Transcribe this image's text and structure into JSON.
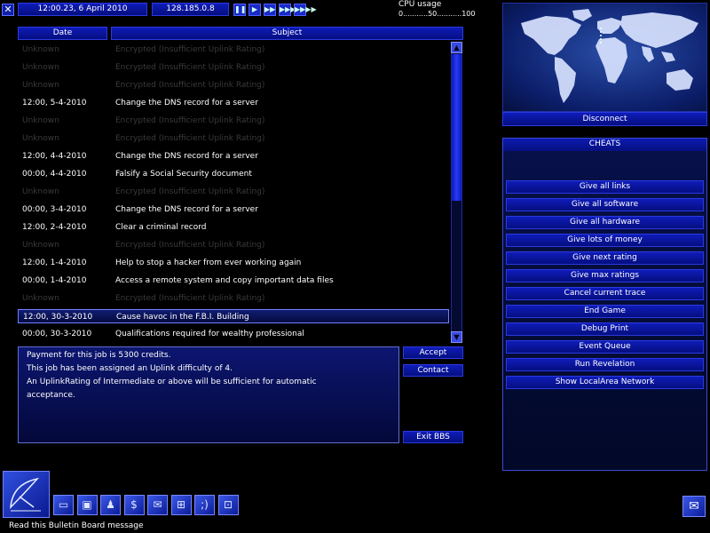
{
  "top_bar": {
    "close_glyph": "✕",
    "datetime": "12:00.23, 6 April 2010",
    "ip_address": "128.185.0.8",
    "speed_buttons": [
      "❚❚",
      "▶",
      "▶▶",
      "▶▶▶",
      "▶▶▶▶"
    ],
    "cpu_label": "CPU usage",
    "cpu_scale": "0...........50...........100"
  },
  "table": {
    "headers": {
      "date": "Date",
      "subject": "Subject"
    },
    "rows": [
      {
        "date": "Unknown",
        "subject": "Encrypted (Insufficient Uplink Rating)",
        "encrypted": true
      },
      {
        "date": "Unknown",
        "subject": "Encrypted (Insufficient Uplink Rating)",
        "encrypted": true
      },
      {
        "date": "Unknown",
        "subject": "Encrypted (Insufficient Uplink Rating)",
        "encrypted": true
      },
      {
        "date": "12:00, 5-4-2010",
        "subject": "Change the DNS record for a server",
        "encrypted": false
      },
      {
        "date": "Unknown",
        "subject": "Encrypted (Insufficient Uplink Rating)",
        "encrypted": true
      },
      {
        "date": "Unknown",
        "subject": "Encrypted (Insufficient Uplink Rating)",
        "encrypted": true
      },
      {
        "date": "12:00, 4-4-2010",
        "subject": "Change the DNS record for a server",
        "encrypted": false
      },
      {
        "date": "00:00, 4-4-2010",
        "subject": "Falsify a Social Security document",
        "encrypted": false
      },
      {
        "date": "Unknown",
        "subject": "Encrypted (Insufficient Uplink Rating)",
        "encrypted": true
      },
      {
        "date": "00:00, 3-4-2010",
        "subject": "Change the DNS record for a server",
        "encrypted": false
      },
      {
        "date": "12:00, 2-4-2010",
        "subject": "Clear a criminal record",
        "encrypted": false
      },
      {
        "date": "Unknown",
        "subject": "Encrypted (Insufficient Uplink Rating)",
        "encrypted": true
      },
      {
        "date": "12:00, 1-4-2010",
        "subject": "Help to stop a hacker from ever working again",
        "encrypted": false
      },
      {
        "date": "00:00, 1-4-2010",
        "subject": "Access a remote system and copy important data files",
        "encrypted": false
      },
      {
        "date": "Unknown",
        "subject": "Encrypted (Insufficient Uplink Rating)",
        "encrypted": true
      },
      {
        "date": "12:00, 30-3-2010",
        "subject": "Cause havoc in the F.B.I. Building",
        "encrypted": false,
        "selected": true
      },
      {
        "date": "00:00, 30-3-2010",
        "subject": "Qualifications required for wealthy professional",
        "encrypted": false
      }
    ]
  },
  "scrollbar": {
    "up_glyph": "▲",
    "down_glyph": "▼"
  },
  "details": {
    "line1": "Payment for this job is 5300 credits.",
    "line2": "This job has been assigned an Uplink difficulty of 4.",
    "line3": "An UplinkRating of Intermediate or above will be sufficient for automatic",
    "line4": "acceptance."
  },
  "actions": {
    "accept": "Accept",
    "contact": "Contact",
    "exit": "Exit BBS"
  },
  "map": {
    "disconnect": "Disconnect"
  },
  "cheats": {
    "title": "CHEATS",
    "items": [
      "Give all links",
      "Give all software",
      "Give all hardware",
      "Give lots of money",
      "Give next rating",
      "Give max ratings",
      "Cancel current trace",
      "End Game",
      "Debug Print",
      "Event Queue",
      "Run Revelation",
      "Show LocalArea Network"
    ]
  },
  "taskbar": {
    "icons": [
      "computer-icon",
      "floppy-disk-icon",
      "people-icon",
      "dollar-icon",
      "mail-envelope-icon",
      "network-icon",
      "smiley-icon",
      "lan-icon"
    ],
    "glyphs": [
      "▭",
      "▣",
      "♟",
      "$",
      "✉",
      "⊞",
      ";)",
      "⊡"
    ],
    "mail_glyph": "✉"
  },
  "status_bar": {
    "text": "Read this Bulletin Board message"
  },
  "colors": {
    "bar_top": "#0f1cb8",
    "bar_bottom": "#050f80",
    "accent": "#2a3ae0",
    "encrypted_text": "#3a3a3a"
  }
}
